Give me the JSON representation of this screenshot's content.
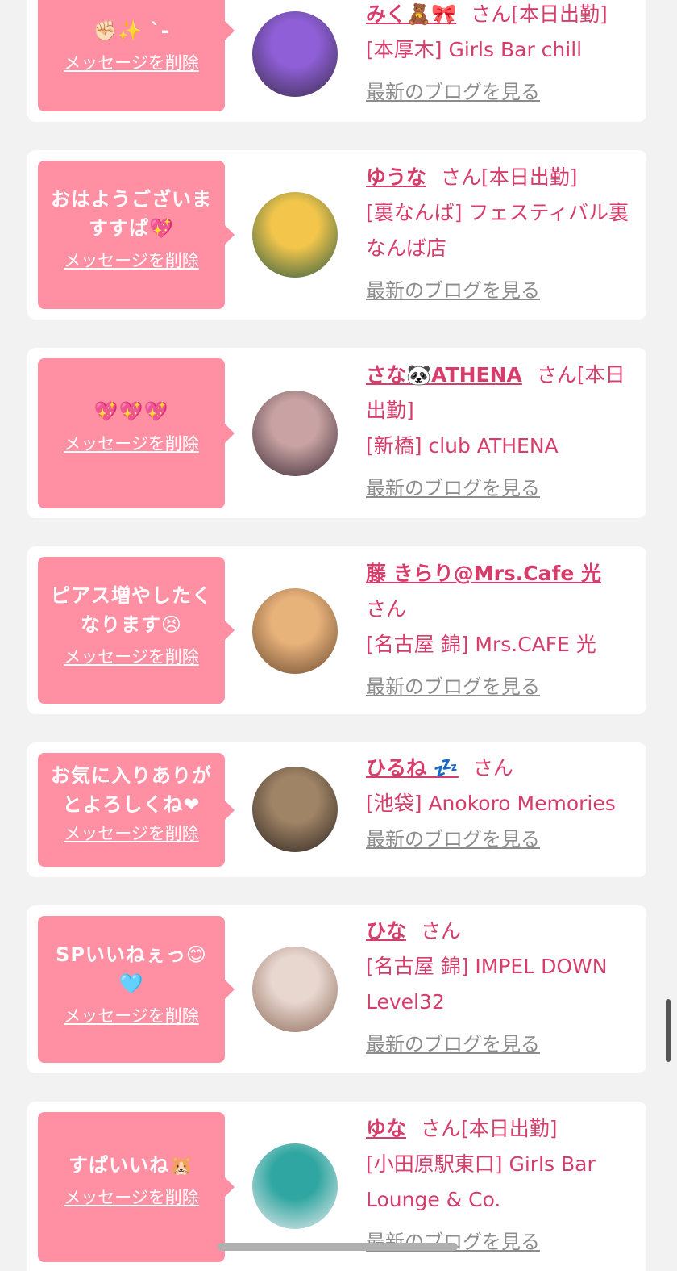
{
  "delete_label": "メッセージを削除",
  "blog_label": "最新のブログを見る",
  "san_label": "さん",
  "colors": {
    "accent": "#d63d6a",
    "bubble": "#ff8fa3",
    "background": "#f2f2f2",
    "link_gray": "#8c8c8c"
  },
  "items": [
    {
      "message": "✊🏻✨ `-",
      "name": "みく🧸🎀",
      "status": "[本日出勤]",
      "shop": "[本厚木] Girls Bar chill",
      "avatar_colors": [
        "#8f5fd8",
        "#3a2d4a"
      ]
    },
    {
      "message": "おはようございますすぱ💖",
      "name": "ゆうな",
      "status": "[本日出勤]",
      "shop": "[裏なんば] フェスティバル裏なんば店",
      "avatar_colors": [
        "#f3c64b",
        "#2b5a43"
      ]
    },
    {
      "message": "💖💖💖",
      "name": "さな🐼ATHENA",
      "status": "[本日出勤]",
      "shop": "[新橋] club ATHENA",
      "avatar_colors": [
        "#c9a3a3",
        "#3b2a35"
      ]
    },
    {
      "message": "ピアス増やしたくなります😣",
      "name": "藤 きらり@Mrs.Cafe 光",
      "status": "",
      "shop": "[名古屋 錦] Mrs.CAFE 光",
      "avatar_colors": [
        "#e8b27b",
        "#6a4a2e"
      ]
    },
    {
      "message": "お気に入りありがとよろしくね❤",
      "name": "ひるね 💤",
      "status": "",
      "shop": "[池袋] Anokoro Memories",
      "avatar_colors": [
        "#a08466",
        "#2d2420"
      ]
    },
    {
      "message": "SPいいねぇっ😊🩵",
      "name": "ひな",
      "status": "",
      "shop": "[名古屋 錦] IMPEL DOWN Level32",
      "avatar_colors": [
        "#e8d7cf",
        "#8d6a5a"
      ]
    },
    {
      "message": "すぱいいね🐹",
      "name": "ゆな",
      "status": "[本日出勤]",
      "shop": "[小田原駅東口] Girls Bar Lounge & Co.",
      "avatar_colors": [
        "#2fa6a1",
        "#f0eef0"
      ]
    }
  ]
}
